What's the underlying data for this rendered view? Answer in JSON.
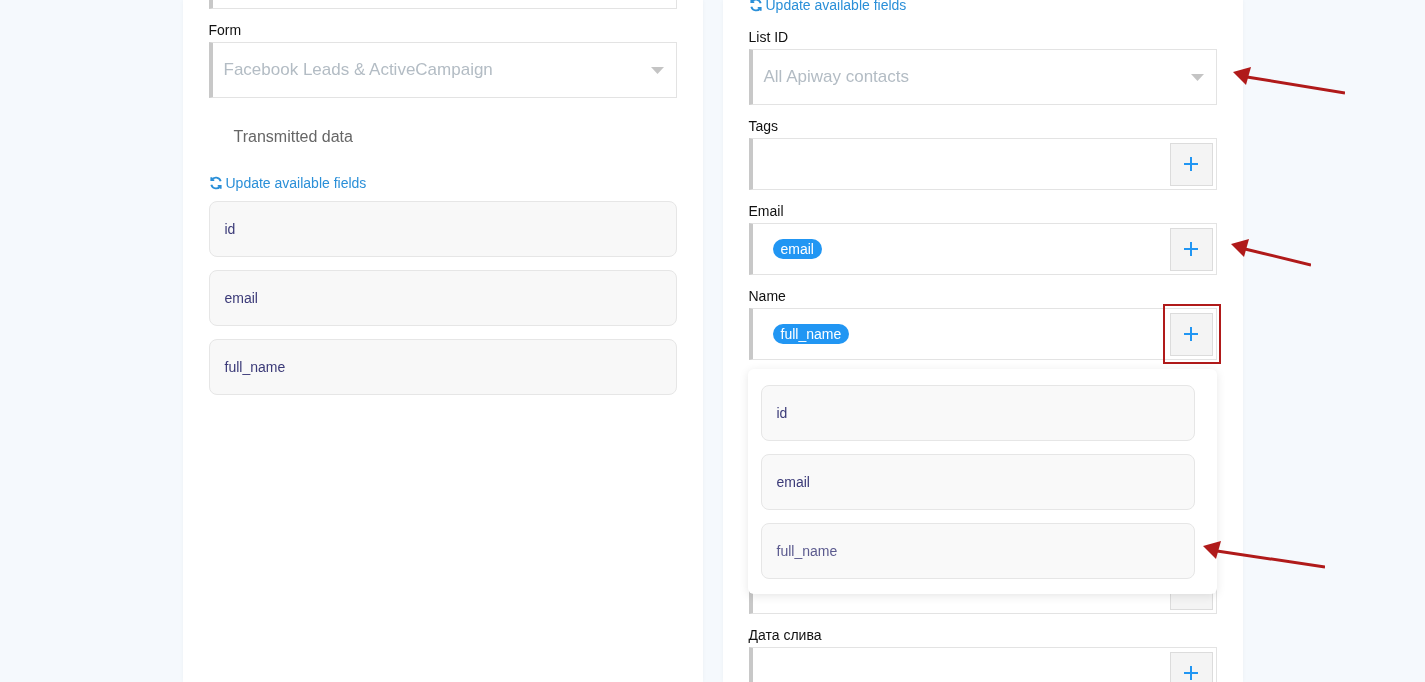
{
  "left_panel": {
    "fields": [
      {
        "kind": "text"
      },
      {
        "kind": "select",
        "label": "Form",
        "placeholder": "Facebook Leads & ActiveCampaign"
      }
    ],
    "section_title": "Transmitted data",
    "update_link": "Update available fields",
    "data_items": [
      "id",
      "email",
      "full_name"
    ]
  },
  "right_panel": {
    "update_link": "Update available fields",
    "fields": [
      {
        "kind": "select",
        "label": "List ID",
        "placeholder": "All Apiway contacts",
        "pointed": true
      },
      {
        "kind": "tags",
        "label": "Tags"
      },
      {
        "kind": "tags",
        "label": "Email",
        "tags": [
          "email"
        ],
        "pointed": true
      },
      {
        "kind": "tags",
        "label": "Name",
        "tags": [
          "full_name"
        ],
        "button_highlighted": true,
        "dropdown": {
          "options": [
            {
              "label": "id"
            },
            {
              "label": "email"
            },
            {
              "label": "full_name",
              "pointed": true
            }
          ]
        }
      },
      {
        "kind": "tags",
        "covered": true
      },
      {
        "kind": "tags",
        "label": "Дата слива"
      }
    ]
  }
}
